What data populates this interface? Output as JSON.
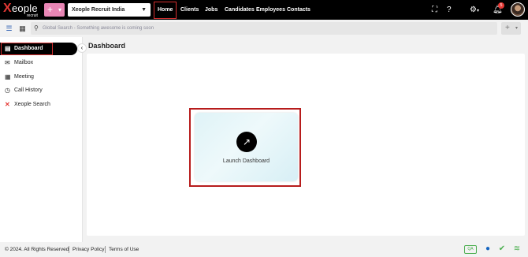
{
  "app": {
    "logo_word": "eople",
    "logo_sub": "recruit",
    "plus_label": "+",
    "org_selector": "Xeople Recruit India"
  },
  "nav": {
    "items": [
      {
        "label": "Home"
      },
      {
        "label": "Clients"
      },
      {
        "label": "Jobs"
      },
      {
        "label": "Candidates"
      },
      {
        "label": "Employees"
      },
      {
        "label": "Contacts"
      }
    ],
    "notification_count": "5"
  },
  "search": {
    "placeholder": "Global Search - Something awesome is coming soon"
  },
  "sidebar": {
    "items": [
      {
        "label": "Dashboard"
      },
      {
        "label": "Mailbox"
      },
      {
        "label": "Meeting"
      },
      {
        "label": "Call History"
      },
      {
        "label": "Xeople Search"
      }
    ]
  },
  "main": {
    "title": "Dashboard",
    "launch_label": "Launch Dashboard"
  },
  "footer": {
    "copyright": "© 2024. All Rights Reserved",
    "privacy": "Privacy Policy",
    "terms": "Terms of Use",
    "env_badge": "QA"
  },
  "colors": {
    "accent": "#e986b5",
    "highlight": "#d32f2f"
  }
}
